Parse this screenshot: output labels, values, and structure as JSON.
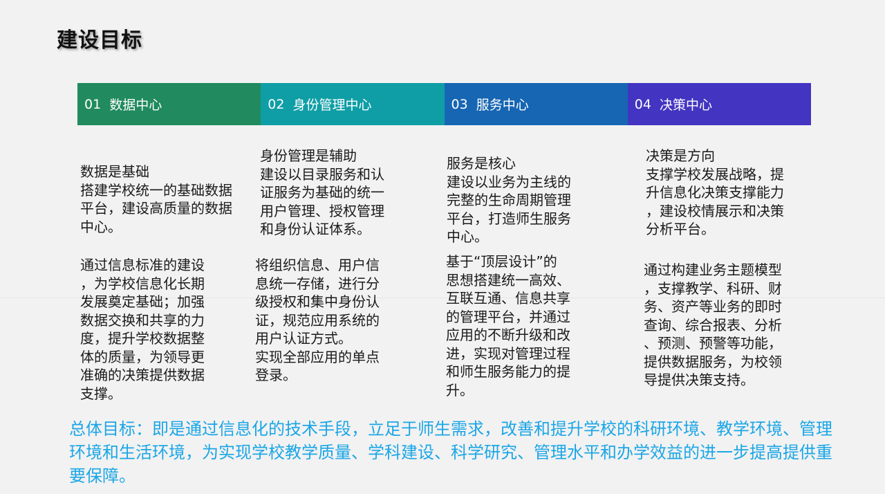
{
  "title": "建设目标",
  "tabs": [
    {
      "num": "01",
      "label": "数据中心",
      "color": "#218a5e"
    },
    {
      "num": "02",
      "label": "身份管理中心",
      "color": "#0f9ea6"
    },
    {
      "num": "03",
      "label": "服务中心",
      "color": "#1766b3"
    },
    {
      "num": "04",
      "label": "决策中心",
      "color": "#4335c1"
    }
  ],
  "columns": [
    {
      "heading": "数据是基础",
      "intro": "搭建学校统一的基础数据\n平台，建设高质量的数据\n中心。",
      "detail": "通过信息标准的建设\n，为学校信息化长期\n发展奠定基础；加强\n数据交换和共享的力\n度，提升学校数据整\n体的质量，为领导更\n准确的决策提供数据\n支撑。"
    },
    {
      "heading": "身份管理是辅助",
      "intro": "建设以目录服务和认\n证服务为基础的统一\n用户管理、授权管理\n和身份认证体系。",
      "detail": "将组织信息、用户信\n息统一存储，进行分\n级授权和集中身份认\n证，规范应用系统的\n用户认证方式。\n实现全部应用的单点\n登录。"
    },
    {
      "heading": "服务是核心",
      "intro": "建设以业务为主线的\n完整的生命周期管理\n平台，打造师生服务\n中心。",
      "detail": "基于“顶层设计”的\n思想搭建统一高效、\n互联互通、信息共享\n的管理平台，并通过\n应用的不断升级和改\n进，实现对管理过程\n和师生服务能力的提\n升。"
    },
    {
      "heading": "决策是方向",
      "intro": "支撑学校发展战略，提\n升信息化决策支撑能力\n，建设校情展示和决策\n分析平台。",
      "detail": "通过构建业务主题模型\n，支撑教学、科研、财\n务、资产等业务的即时\n查询、综合报表、分析\n、预测、预警等功能，\n提供数据服务，为校领\n导提供决策支持。"
    }
  ],
  "summary": "总体目标：即是通过信息化的技术手段，立足于师生需求，改善和提升学校的科研环境、教学环境、管理环境和生活环境，为实现学校教学质量、学科建设、科学研究、管理水平和办学效益的进一步提高提供重要保障。"
}
